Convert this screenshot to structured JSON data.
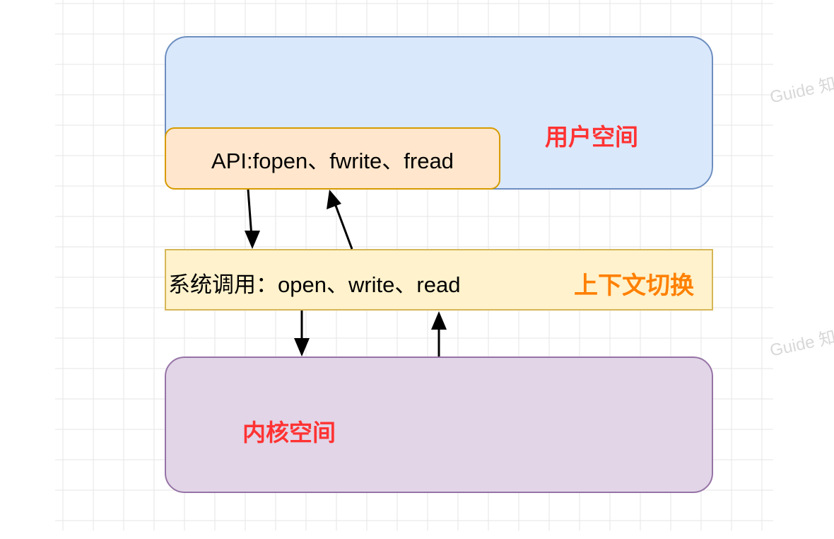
{
  "diagram": {
    "user_space_label": "用户空间",
    "kernel_space_label": "内核空间",
    "api_label": "API:fopen、fwrite、fread",
    "syscall_label": "系统调用：open、write、read",
    "context_switch_label": "上下文切换",
    "watermark_text": "Guide 知"
  },
  "colors": {
    "user_space_fill": "#dae8fc",
    "user_space_border": "#6c8ebf",
    "kernel_space_fill": "#e1d5e7",
    "kernel_space_border": "#9673a6",
    "api_fill": "#ffe6cc",
    "api_border": "#d79b00",
    "syscall_fill": "#fff2cc",
    "syscall_border": "#d6b656",
    "space_label": "#ff3333",
    "context_switch_label": "#ff8000",
    "grid_line": "#e6e6e6",
    "arrow": "#000000"
  }
}
